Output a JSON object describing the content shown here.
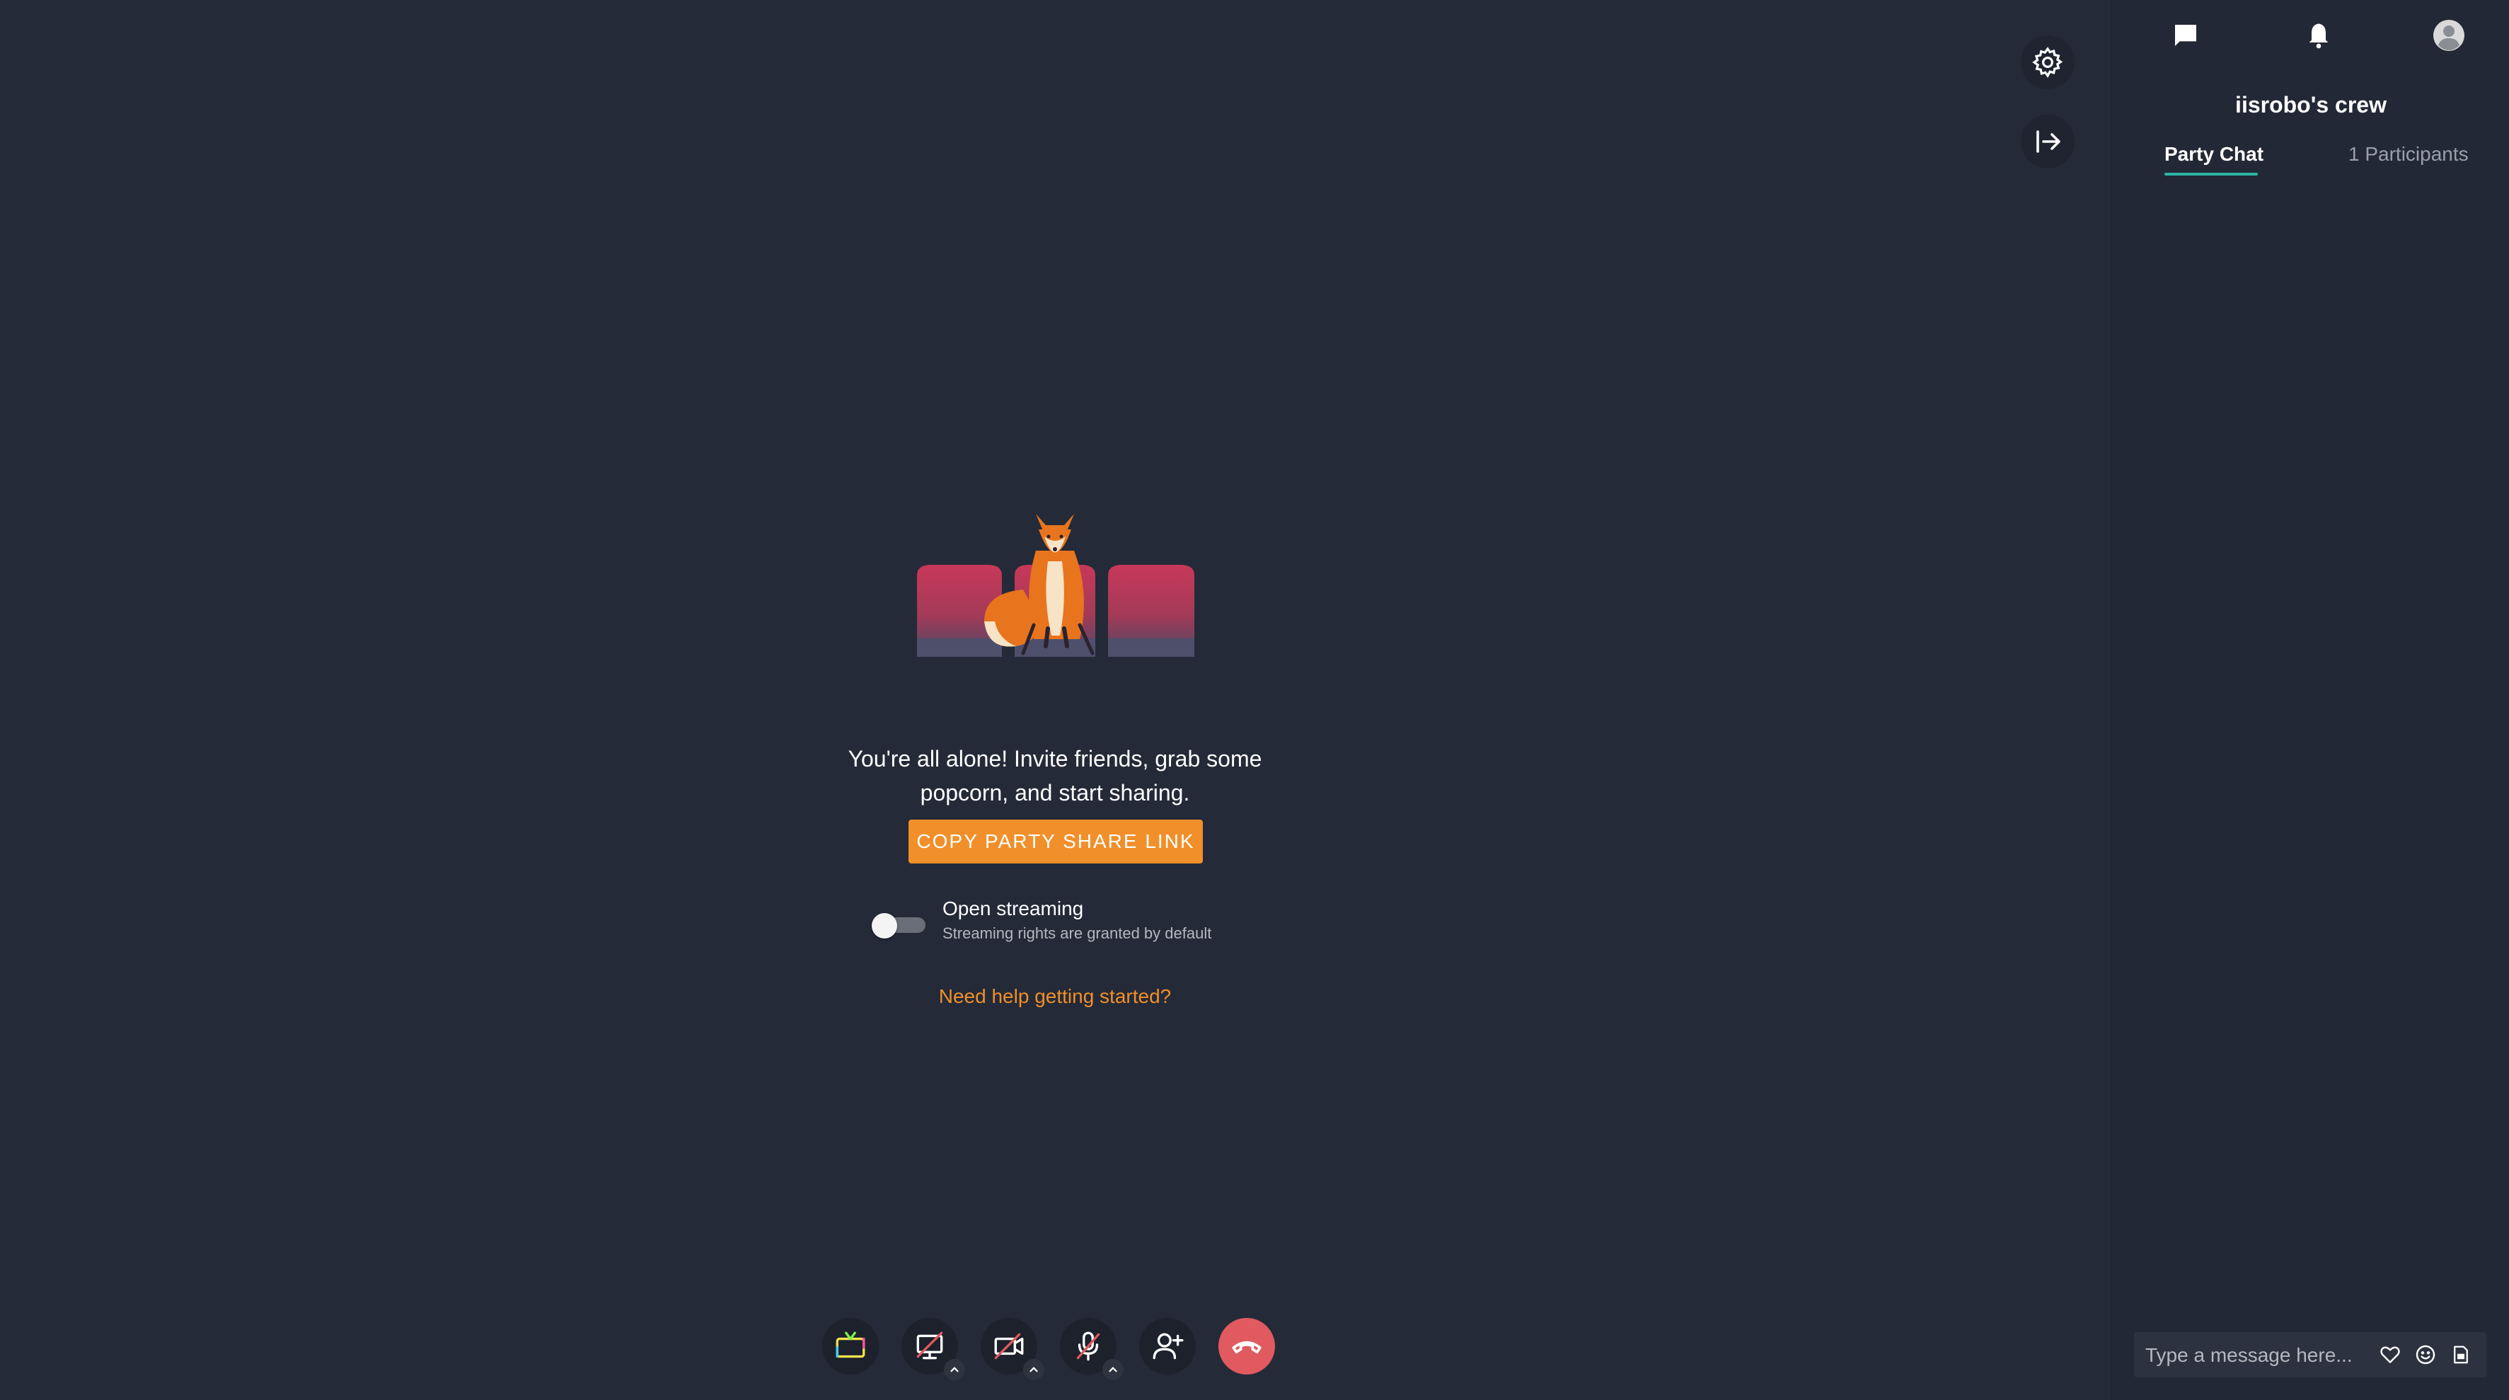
{
  "main": {
    "message": "You're all alone! Invite friends, grab some popcorn, and start sharing.",
    "copy_button": "COPY PARTY SHARE LINK",
    "streaming_title": "Open streaming",
    "streaming_subtitle": "Streaming rights are granted by default",
    "streaming_enabled": false,
    "help_link": "Need help getting started?"
  },
  "top_controls": {
    "settings_icon": "gear-icon",
    "exit_icon": "exit-arrow-icon"
  },
  "bottom_controls": {
    "items": [
      "tv-icon",
      "screen-share-off-icon",
      "camera-off-icon",
      "mic-off-icon",
      "add-user-icon",
      "end-call-icon"
    ]
  },
  "sidebar": {
    "icons": [
      "chat-icon",
      "bell-icon",
      "user-avatar-icon"
    ],
    "title": "iisrobo's crew",
    "tabs": [
      {
        "label": "Party Chat",
        "active": true
      },
      {
        "label": "1 Participants",
        "active": false
      }
    ],
    "chat_placeholder": "Type a message here...",
    "chat_icons": [
      "heart-icon",
      "smile-icon",
      "gif-icon"
    ]
  },
  "colors": {
    "background": "#242a38",
    "accent": "#f18f2a",
    "end_call": "#e05a5f",
    "tab_underline": "#2bb5a5"
  }
}
